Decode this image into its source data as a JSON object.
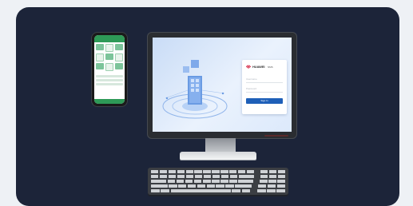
{
  "phone": {
    "title": "",
    "accent": "#2e9a57"
  },
  "login": {
    "brand": "HUAWEI",
    "title": "NMS",
    "username_placeholder": "Username",
    "password_placeholder": "Password",
    "signin_label": "Sign In",
    "accent": "#1e5fb8"
  },
  "colors": {
    "card_bg": "#1c2439",
    "page_bg": "#eef1f5"
  }
}
